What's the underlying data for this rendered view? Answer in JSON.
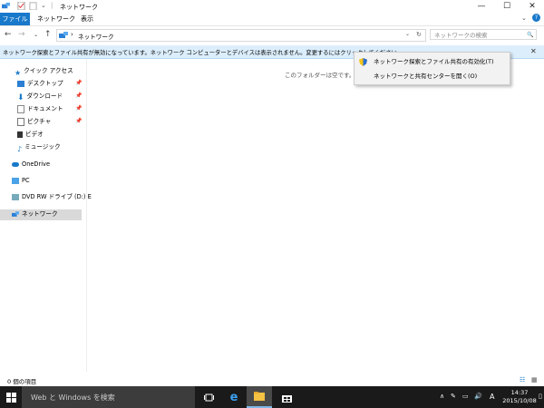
{
  "window": {
    "title": "ネットワーク",
    "controls": {
      "minimize": "—",
      "maximize": "☐",
      "close": "✕"
    }
  },
  "ribbon": {
    "tabs": [
      {
        "label": "ファイル",
        "active": true
      },
      {
        "label": "ネットワーク"
      },
      {
        "label": "表示"
      }
    ],
    "expand_glyph": "⌄",
    "help_glyph": "?"
  },
  "address": {
    "path_separator": "›",
    "location": "ネットワーク",
    "dropdown_glyph": "⌄",
    "refresh_glyph": "↻",
    "search_placeholder": "ネットワークの検索",
    "search_glyph": "🔍"
  },
  "infobar": {
    "message": "ネットワーク探索とファイル共有が無効になっています。ネットワーク コンピューターとデバイスは表示されません。変更するにはクリックしてください...",
    "close_glyph": "✕"
  },
  "navpane": {
    "items": [
      {
        "label": "クイック アクセス",
        "icon": "star-icon"
      },
      {
        "label": "デスクトップ",
        "icon": "desktop-icon",
        "pinned": true
      },
      {
        "label": "ダウンロード",
        "icon": "download-icon",
        "pinned": true
      },
      {
        "label": "ドキュメント",
        "icon": "document-icon",
        "pinned": true
      },
      {
        "label": "ピクチャ",
        "icon": "pictures-icon",
        "pinned": true
      },
      {
        "label": "ビデオ",
        "icon": "video-icon"
      },
      {
        "label": "ミュージック",
        "icon": "music-icon"
      },
      {
        "label": "OneDrive",
        "icon": "cloud-icon"
      },
      {
        "label": "PC",
        "icon": "pc-icon"
      },
      {
        "label": "DVD RW ドライブ (D:) E",
        "icon": "dvd-icon"
      },
      {
        "label": "ネットワーク",
        "icon": "network-icon",
        "selected": true
      }
    ]
  },
  "content": {
    "empty_message": "このフォルダーは空です。"
  },
  "context_menu": {
    "items": [
      {
        "label": "ネットワーク探索とファイル共有の有効化(T)",
        "icon": "shield-icon"
      },
      {
        "label": "ネットワークと共有センターを開く(O)"
      }
    ]
  },
  "statusbar": {
    "item_count": "0 個の項目"
  },
  "taskbar": {
    "search_text": "Web と Windows を検索",
    "ime": "A",
    "time": "14:37",
    "date": "2015/10/08"
  },
  "colors": {
    "accent": "#1979ca",
    "infobar": "#dceefc",
    "taskbar": "#1a1a1a"
  }
}
